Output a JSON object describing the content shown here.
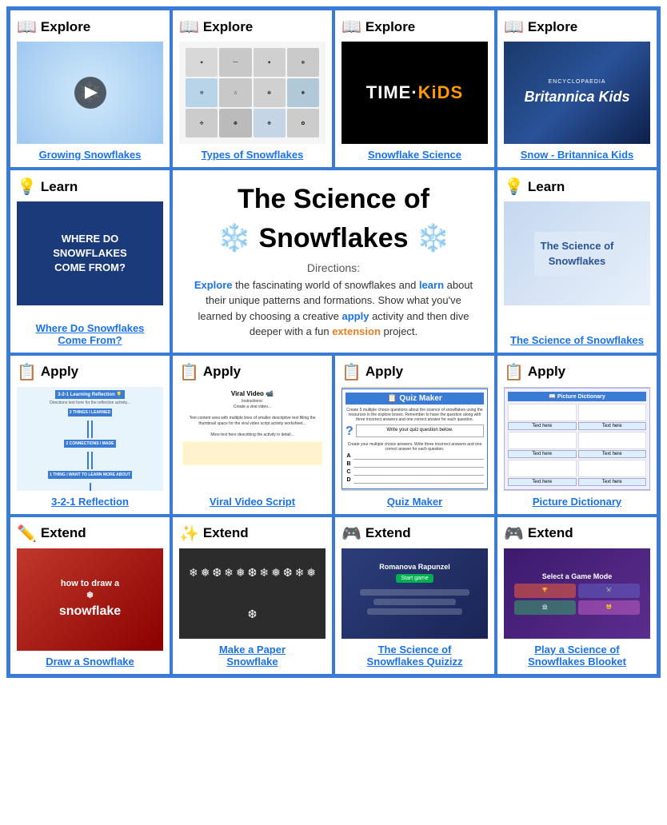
{
  "page": {
    "title": "The Science of Snowflakes",
    "border_color": "#3a7bd5"
  },
  "center": {
    "title_line1": "The Science of",
    "title_line2": "❄️ Snowflakes ❄️",
    "directions_label": "Directions:",
    "directions": "the fascinating world of snowflakes and",
    "directions2": "about their unique patterns and formations. Show what you've learned by choosing a creative",
    "directions3": "activity and then dive deeper with a fun",
    "directions4": "project.",
    "explore_word": "Explore",
    "learn_word": "learn",
    "apply_word": "apply",
    "extension_word": "extension"
  },
  "row1": {
    "cells": [
      {
        "category": "Explore",
        "icon": "📖",
        "link": "Growing Snowflakes",
        "img_type": "snowflake-grow"
      },
      {
        "category": "Explore",
        "icon": "📖",
        "link": "Types of Snowflakes",
        "img_type": "types"
      },
      {
        "category": "Explore",
        "icon": "📖",
        "link": "Snowflake Science",
        "img_type": "timekids"
      },
      {
        "category": "Explore",
        "icon": "📖",
        "link": "Snow - Britannica Kids",
        "img_type": "britannica"
      }
    ]
  },
  "row2_sides": {
    "left": {
      "category": "Learn",
      "icon": "💡",
      "link_line1": "Where Do Snowflakes",
      "link_line2": "Come From?",
      "img_type": "where"
    },
    "right": {
      "category": "Learn",
      "icon": "💡",
      "link": "The Science of Snowflakes",
      "img_type": "science-book"
    }
  },
  "row3": {
    "cells": [
      {
        "category": "Apply",
        "icon": "📋",
        "link": "3-2-1 Reflection",
        "img_type": "reflection"
      },
      {
        "category": "Apply",
        "icon": "📋",
        "link": "Viral Video Script",
        "img_type": "viral"
      },
      {
        "category": "Apply",
        "icon": "📋",
        "link": "Quiz Maker",
        "img_type": "quiz"
      },
      {
        "category": "Apply",
        "icon": "📋",
        "link": "Picture Dictionary",
        "img_type": "picdict"
      }
    ]
  },
  "row4": {
    "cells": [
      {
        "category": "Extend",
        "icon": "✏️",
        "link": "Draw a Snowflake",
        "img_type": "draw"
      },
      {
        "category": "Extend",
        "icon": "✨",
        "link_line1": "Make a Paper",
        "link_line2": "Snowflake",
        "img_type": "paper"
      },
      {
        "category": "Extend",
        "icon": "🎮",
        "link_line1": "The Science of",
        "link_line2": "Snowflakes Quizizz",
        "img_type": "quizizz"
      },
      {
        "category": "Extend",
        "icon": "🎮",
        "link_line1": "Play a Science of",
        "link_line2": "Snowflakes Blooket",
        "img_type": "blooket"
      }
    ]
  }
}
